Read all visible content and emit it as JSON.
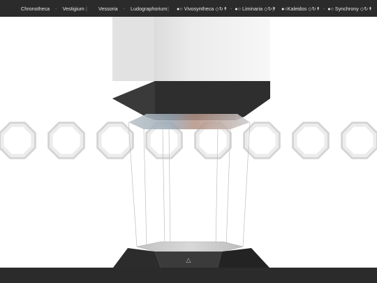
{
  "nav": {
    "chronotheca": "Chronotheca",
    "dash1": "-",
    "vestigium": "Vestigium",
    "sep1": "|",
    "vessoria": "Vessoria",
    "dash2": "-",
    "ludographorium": "Ludographorium",
    "sep2": "|",
    "vivosyntheca": "●○ Vivosyntheca ◇↻↟",
    "dash3": "-",
    "liminaria": "●○ Liminaria ◇↻↟",
    "sep3": "|",
    "kaleidos": "●○Kaleidos ◇↻↟",
    "dash4": "-",
    "synchrony": "●○ Synchrony ◇↻↟"
  },
  "scene": {
    "center_emblem": "△",
    "ring_count": 8
  },
  "colors": {
    "bar_bg": "#2b2b2b",
    "bar_text": "#e6e6e6",
    "column_light": "#efefef",
    "column_dark": "#2f2f2f",
    "ring": "#d6d6d6"
  }
}
